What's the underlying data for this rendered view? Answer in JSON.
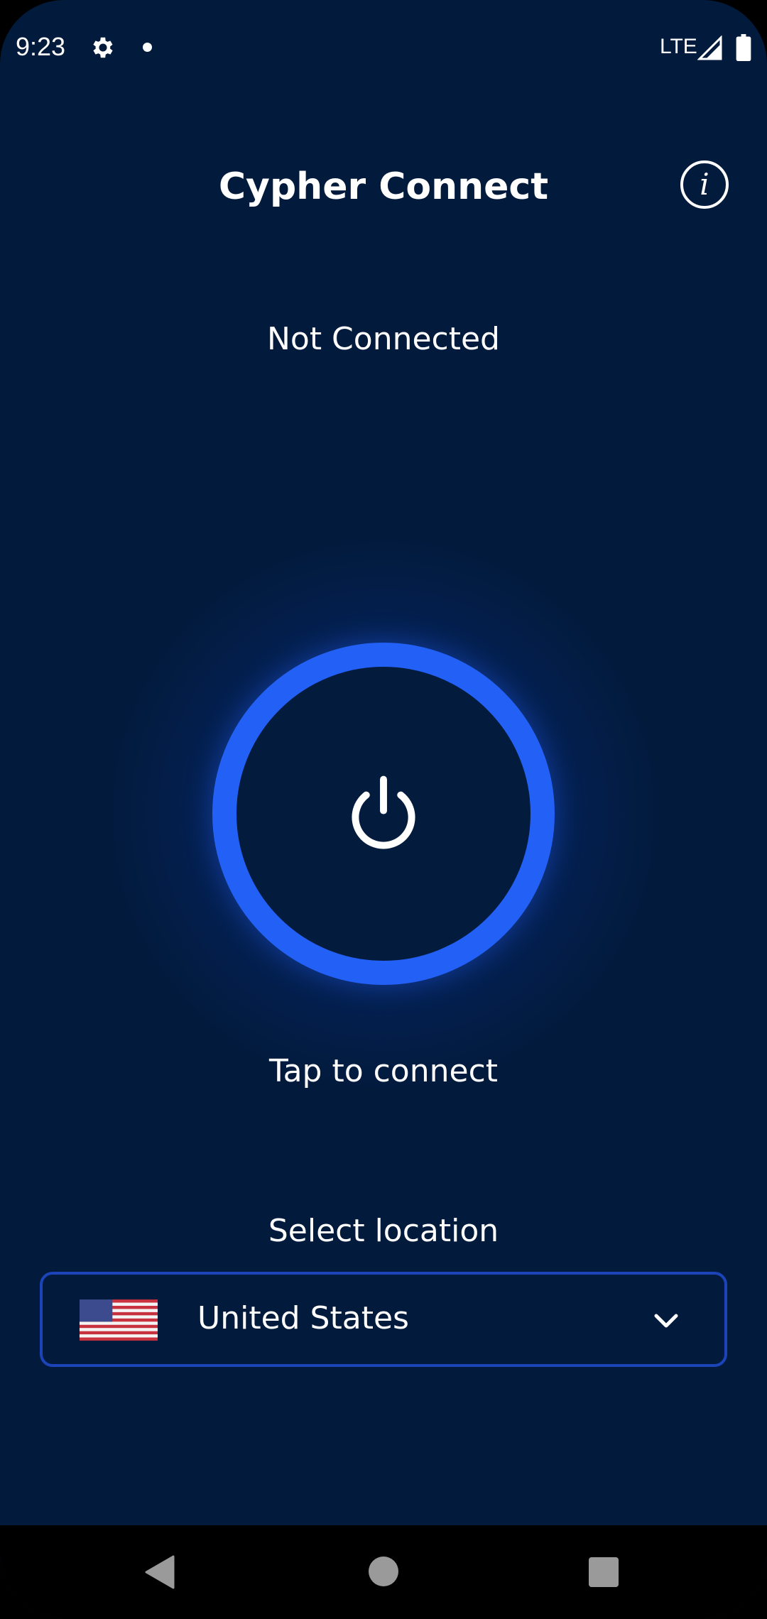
{
  "status_bar": {
    "time": "9:23",
    "network": "LTE",
    "settings_icon": "gear-icon",
    "signal_icon": "cell-signal-icon",
    "battery_icon": "battery-icon"
  },
  "header": {
    "title": "Cypher Connect",
    "info_icon": "info-icon",
    "info_glyph": "i"
  },
  "connection": {
    "status": "Not Connected",
    "power_icon": "power-icon",
    "hint": "Tap to connect"
  },
  "location": {
    "label": "Select location",
    "selected": "United States",
    "flag_icon": "us-flag-icon",
    "dropdown_icon": "chevron-down-icon"
  },
  "navigation": {
    "back_icon": "back-icon",
    "home_icon": "home-icon",
    "recents_icon": "recents-icon"
  },
  "colors": {
    "background": "#021a3b",
    "accent": "#2360f5",
    "select_border": "#1a44b8",
    "text": "#ffffff"
  }
}
